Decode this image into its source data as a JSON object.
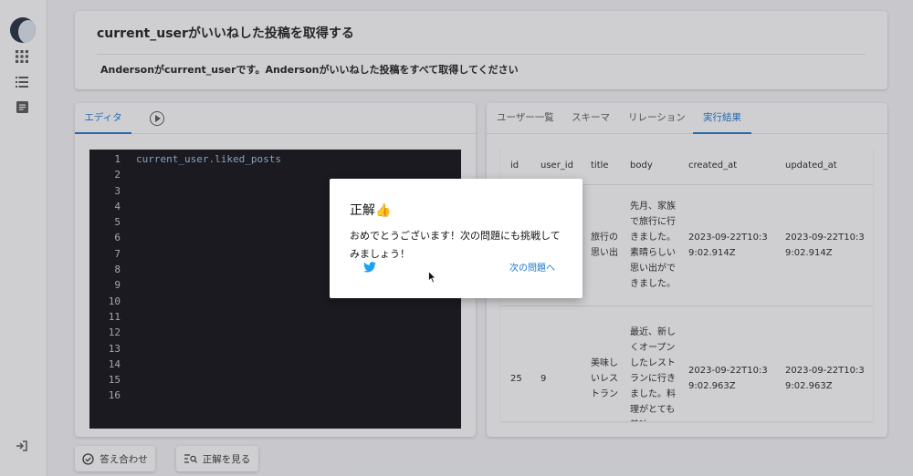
{
  "problem": {
    "title": "current_userがいいねした投稿を取得する",
    "description": "Andersonがcurrent_userです。Andersonがいいねした投稿をすべて取得してください"
  },
  "sidebar": {
    "icons": [
      "apps-icon",
      "list-icon",
      "document-icon"
    ],
    "logout_icon": "logout-icon"
  },
  "editor": {
    "tab_label": "エディタ",
    "line_numbers": [
      "1",
      "2",
      "3",
      "4",
      "5",
      "6",
      "7",
      "8",
      "9",
      "10",
      "11",
      "12",
      "13",
      "14",
      "15",
      "16"
    ],
    "code": "current_user.liked_posts"
  },
  "result_tabs": [
    "ユーザー一覧",
    "スキーマ",
    "リレーション",
    "実行結果"
  ],
  "result_table": {
    "columns": [
      "id",
      "user_id",
      "title",
      "body",
      "created_at",
      "updated_at"
    ],
    "rows": [
      [
        "",
        "",
        "旅行の思い出",
        "先月、家族で旅行に行きました。素晴らしい思い出ができました。",
        "2023-09-22T10:39:02.914Z",
        "2023-09-22T10:39:02.914Z"
      ],
      [
        "25",
        "9",
        "美味しいレストラン",
        "最近、新しくオープンしたレストランに行きました。料理がとても美味",
        "2023-09-22T10:39:02.963Z",
        "2023-09-22T10:39:02.963Z"
      ]
    ]
  },
  "buttons": {
    "check_answer": "答え合わせ",
    "show_answer": "正解を見る"
  },
  "modal": {
    "title": "正解👍",
    "message": "おめでとうございます！次の問題にも挑戦してみましょう！",
    "next_link": "次の問題へ"
  },
  "colors": {
    "accent": "#1976d2",
    "editor_bg": "#0b0b0f",
    "twitter": "#1da1f2"
  }
}
